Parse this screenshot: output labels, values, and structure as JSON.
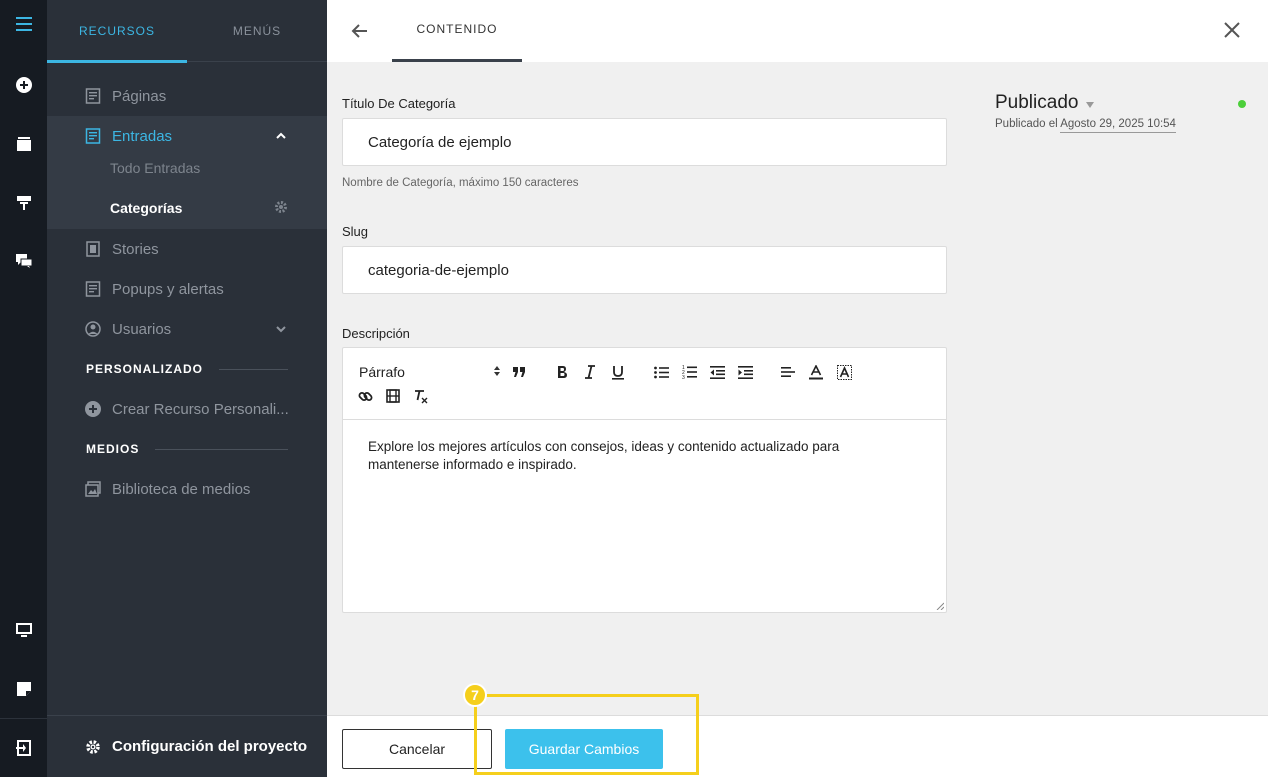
{
  "sidebar": {
    "tabs": [
      {
        "label": "RECURSOS"
      },
      {
        "label": "MENÚS"
      }
    ],
    "items": {
      "paginas": "Páginas",
      "entradas": "Entradas",
      "todo_entradas": "Todo Entradas",
      "categorias": "Categorías",
      "stories": "Stories",
      "popups": "Popups y alertas",
      "usuarios": "Usuarios",
      "crear_recurso": "Crear Recurso Personali...",
      "biblioteca": "Biblioteca de medios"
    },
    "sections": {
      "personalizado": "PERSONALIZADO",
      "medios": "MEDIOS"
    },
    "footer": "Configuración del proyecto"
  },
  "header": {
    "tab": "CONTENIDO"
  },
  "form": {
    "title_label": "Título De Categoría",
    "title_value": "Categoría de ejemplo",
    "title_hint": "Nombre de Categoría, máximo 150 caracteres",
    "slug_label": "Slug",
    "slug_value": "categoria-de-ejemplo",
    "description_label": "Descripción",
    "format_select": "Párrafo",
    "description_value": "Explore los mejores artículos con consejos, ideas y contenido actualizado para mantenerse informado e inspirado."
  },
  "status": {
    "label": "Publicado",
    "published_prefix": "Publicado el",
    "published_date": "Agosto 29, 2025 10:54",
    "dot_color": "#4ccf3a"
  },
  "footer_actions": {
    "cancel": "Cancelar",
    "save": "Guardar Cambios"
  },
  "annotation": {
    "step": "7",
    "color": "#f5cf1c"
  },
  "colors": {
    "accent": "#3cb6e3",
    "save_button": "#3cc1ec",
    "sidebar": "#2a3039",
    "rail": "#161b22"
  }
}
